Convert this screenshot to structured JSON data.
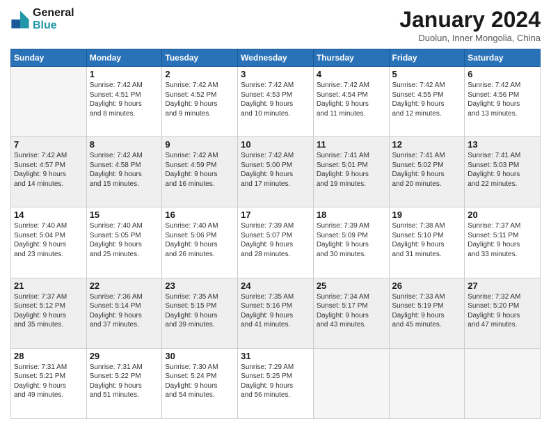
{
  "header": {
    "logo_line1": "General",
    "logo_line2": "Blue",
    "month_title": "January 2024",
    "subtitle": "Duolun, Inner Mongolia, China"
  },
  "days_of_week": [
    "Sunday",
    "Monday",
    "Tuesday",
    "Wednesday",
    "Thursday",
    "Friday",
    "Saturday"
  ],
  "weeks": [
    [
      {
        "day": "",
        "empty": true
      },
      {
        "day": "1",
        "sunrise": "7:42 AM",
        "sunset": "4:51 PM",
        "daylight": "9 hours and 8 minutes."
      },
      {
        "day": "2",
        "sunrise": "7:42 AM",
        "sunset": "4:52 PM",
        "daylight": "9 hours and 9 minutes."
      },
      {
        "day": "3",
        "sunrise": "7:42 AM",
        "sunset": "4:53 PM",
        "daylight": "9 hours and 10 minutes."
      },
      {
        "day": "4",
        "sunrise": "7:42 AM",
        "sunset": "4:54 PM",
        "daylight": "9 hours and 11 minutes."
      },
      {
        "day": "5",
        "sunrise": "7:42 AM",
        "sunset": "4:55 PM",
        "daylight": "9 hours and 12 minutes."
      },
      {
        "day": "6",
        "sunrise": "7:42 AM",
        "sunset": "4:56 PM",
        "daylight": "9 hours and 13 minutes."
      }
    ],
    [
      {
        "day": "7",
        "sunrise": "7:42 AM",
        "sunset": "4:57 PM",
        "daylight": "9 hours and 14 minutes."
      },
      {
        "day": "8",
        "sunrise": "7:42 AM",
        "sunset": "4:58 PM",
        "daylight": "9 hours and 15 minutes."
      },
      {
        "day": "9",
        "sunrise": "7:42 AM",
        "sunset": "4:59 PM",
        "daylight": "9 hours and 16 minutes."
      },
      {
        "day": "10",
        "sunrise": "7:42 AM",
        "sunset": "5:00 PM",
        "daylight": "9 hours and 17 minutes."
      },
      {
        "day": "11",
        "sunrise": "7:41 AM",
        "sunset": "5:01 PM",
        "daylight": "9 hours and 19 minutes."
      },
      {
        "day": "12",
        "sunrise": "7:41 AM",
        "sunset": "5:02 PM",
        "daylight": "9 hours and 20 minutes."
      },
      {
        "day": "13",
        "sunrise": "7:41 AM",
        "sunset": "5:03 PM",
        "daylight": "9 hours and 22 minutes."
      }
    ],
    [
      {
        "day": "14",
        "sunrise": "7:40 AM",
        "sunset": "5:04 PM",
        "daylight": "9 hours and 23 minutes."
      },
      {
        "day": "15",
        "sunrise": "7:40 AM",
        "sunset": "5:05 PM",
        "daylight": "9 hours and 25 minutes."
      },
      {
        "day": "16",
        "sunrise": "7:40 AM",
        "sunset": "5:06 PM",
        "daylight": "9 hours and 26 minutes."
      },
      {
        "day": "17",
        "sunrise": "7:39 AM",
        "sunset": "5:07 PM",
        "daylight": "9 hours and 28 minutes."
      },
      {
        "day": "18",
        "sunrise": "7:39 AM",
        "sunset": "5:09 PM",
        "daylight": "9 hours and 30 minutes."
      },
      {
        "day": "19",
        "sunrise": "7:38 AM",
        "sunset": "5:10 PM",
        "daylight": "9 hours and 31 minutes."
      },
      {
        "day": "20",
        "sunrise": "7:37 AM",
        "sunset": "5:11 PM",
        "daylight": "9 hours and 33 minutes."
      }
    ],
    [
      {
        "day": "21",
        "sunrise": "7:37 AM",
        "sunset": "5:12 PM",
        "daylight": "9 hours and 35 minutes."
      },
      {
        "day": "22",
        "sunrise": "7:36 AM",
        "sunset": "5:14 PM",
        "daylight": "9 hours and 37 minutes."
      },
      {
        "day": "23",
        "sunrise": "7:35 AM",
        "sunset": "5:15 PM",
        "daylight": "9 hours and 39 minutes."
      },
      {
        "day": "24",
        "sunrise": "7:35 AM",
        "sunset": "5:16 PM",
        "daylight": "9 hours and 41 minutes."
      },
      {
        "day": "25",
        "sunrise": "7:34 AM",
        "sunset": "5:17 PM",
        "daylight": "9 hours and 43 minutes."
      },
      {
        "day": "26",
        "sunrise": "7:33 AM",
        "sunset": "5:19 PM",
        "daylight": "9 hours and 45 minutes."
      },
      {
        "day": "27",
        "sunrise": "7:32 AM",
        "sunset": "5:20 PM",
        "daylight": "9 hours and 47 minutes."
      }
    ],
    [
      {
        "day": "28",
        "sunrise": "7:31 AM",
        "sunset": "5:21 PM",
        "daylight": "9 hours and 49 minutes."
      },
      {
        "day": "29",
        "sunrise": "7:31 AM",
        "sunset": "5:22 PM",
        "daylight": "9 hours and 51 minutes."
      },
      {
        "day": "30",
        "sunrise": "7:30 AM",
        "sunset": "5:24 PM",
        "daylight": "9 hours and 54 minutes."
      },
      {
        "day": "31",
        "sunrise": "7:29 AM",
        "sunset": "5:25 PM",
        "daylight": "9 hours and 56 minutes."
      },
      {
        "day": "",
        "empty": true
      },
      {
        "day": "",
        "empty": true
      },
      {
        "day": "",
        "empty": true
      }
    ]
  ],
  "labels": {
    "sunrise_label": "Sunrise:",
    "sunset_label": "Sunset:",
    "daylight_label": "Daylight:"
  }
}
